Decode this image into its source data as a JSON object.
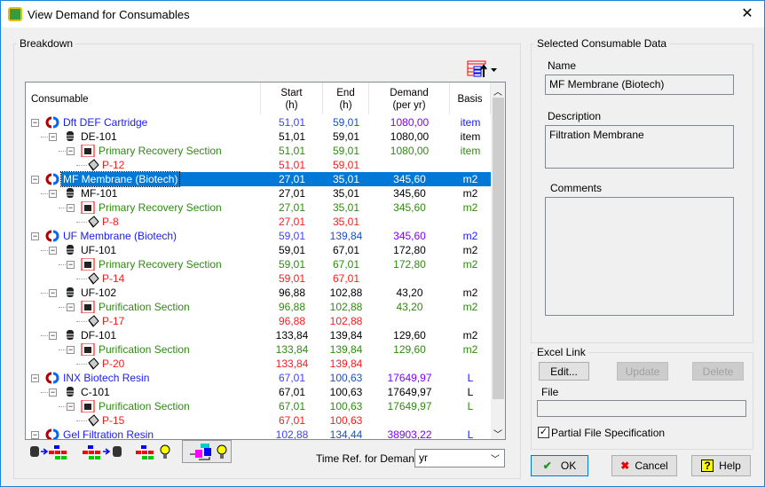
{
  "window": {
    "title": "View Demand for Consumables",
    "close": "✕"
  },
  "breakdown": {
    "label": "Breakdown",
    "columns": [
      "Consumable",
      "Start\n(h)",
      "End\n(h)",
      "Demand\n(per yr)",
      "Basis"
    ],
    "rows": [
      {
        "type": "consumable",
        "label": "Dft DEF Cartridge",
        "start": "51,01",
        "end": "59,01",
        "demand": "1080,00",
        "basis": "item"
      },
      {
        "type": "equipment",
        "label": "DE-101",
        "start": "51,01",
        "end": "59,01",
        "demand": "1080,00",
        "basis": "item"
      },
      {
        "type": "section",
        "label": "Primary Recovery Section",
        "start": "51,01",
        "end": "59,01",
        "demand": "1080,00",
        "basis": "item"
      },
      {
        "type": "procedure",
        "label": "P-12",
        "start": "51,01",
        "end": "59,01",
        "demand": "",
        "basis": ""
      },
      {
        "type": "consumable",
        "label": "MF Membrane (Biotech)",
        "start": "27,01",
        "end": "35,01",
        "demand": "345,60",
        "basis": "m2",
        "selected": true
      },
      {
        "type": "equipment",
        "label": "MF-101",
        "start": "27,01",
        "end": "35,01",
        "demand": "345,60",
        "basis": "m2"
      },
      {
        "type": "section",
        "label": "Primary Recovery Section",
        "start": "27,01",
        "end": "35,01",
        "demand": "345,60",
        "basis": "m2"
      },
      {
        "type": "procedure",
        "label": "P-8",
        "start": "27,01",
        "end": "35,01",
        "demand": "",
        "basis": ""
      },
      {
        "type": "consumable",
        "label": "UF Membrane (Biotech)",
        "start": "59,01",
        "end": "139,84",
        "demand": "345,60",
        "basis": "m2"
      },
      {
        "type": "equipment",
        "label": "UF-101",
        "start": "59,01",
        "end": "67,01",
        "demand": "172,80",
        "basis": "m2"
      },
      {
        "type": "section",
        "label": "Primary Recovery Section",
        "start": "59,01",
        "end": "67,01",
        "demand": "172,80",
        "basis": "m2"
      },
      {
        "type": "procedure",
        "label": "P-14",
        "start": "59,01",
        "end": "67,01",
        "demand": "",
        "basis": ""
      },
      {
        "type": "equipment",
        "label": "UF-102",
        "start": "96,88",
        "end": "102,88",
        "demand": "43,20",
        "basis": "m2"
      },
      {
        "type": "section",
        "label": "Purification Section",
        "start": "96,88",
        "end": "102,88",
        "demand": "43,20",
        "basis": "m2"
      },
      {
        "type": "procedure",
        "label": "P-17",
        "start": "96,88",
        "end": "102,88",
        "demand": "",
        "basis": ""
      },
      {
        "type": "equipment",
        "label": "DF-101",
        "start": "133,84",
        "end": "139,84",
        "demand": "129,60",
        "basis": "m2"
      },
      {
        "type": "section",
        "label": "Purification Section",
        "start": "133,84",
        "end": "139,84",
        "demand": "129,60",
        "basis": "m2"
      },
      {
        "type": "procedure",
        "label": "P-20",
        "start": "133,84",
        "end": "139,84",
        "demand": "",
        "basis": ""
      },
      {
        "type": "consumable",
        "label": "INX Biotech Resin",
        "start": "67,01",
        "end": "100,63",
        "demand": "17649,97",
        "basis": "L"
      },
      {
        "type": "equipment",
        "label": "C-101",
        "start": "67,01",
        "end": "100,63",
        "demand": "17649,97",
        "basis": "L"
      },
      {
        "type": "section",
        "label": "Purification Section",
        "start": "67,01",
        "end": "100,63",
        "demand": "17649,97",
        "basis": "L"
      },
      {
        "type": "procedure",
        "label": "P-15",
        "start": "67,01",
        "end": "100,63",
        "demand": "",
        "basis": ""
      },
      {
        "type": "consumable",
        "label": "Gel Filtration Resin",
        "start": "102,88",
        "end": "134,44",
        "demand": "38903,22",
        "basis": "L"
      }
    ],
    "time_ref_label": "Time Ref. for Demand",
    "time_ref_value": "yr"
  },
  "colors": {
    "consumable": "#1a1aff",
    "equipment": "#000000",
    "section": "#2e8b10",
    "procedure": "#ff1a1a",
    "selection": "#0078d7"
  },
  "selected": {
    "label": "Selected Consumable Data",
    "name_label": "Name",
    "name": "MF Membrane (Biotech)",
    "description_label": "Description",
    "description": "Filtration Membrane",
    "comments_label": "Comments",
    "comments": ""
  },
  "excel": {
    "label": "Excel Link",
    "edit": "Edit...",
    "update": "Update",
    "delete": "Delete",
    "file_label": "File",
    "file": "",
    "partial_label": "Partial File Specification",
    "partial_checked": true
  },
  "buttons": {
    "ok": "OK",
    "cancel": "Cancel",
    "help": "Help"
  }
}
